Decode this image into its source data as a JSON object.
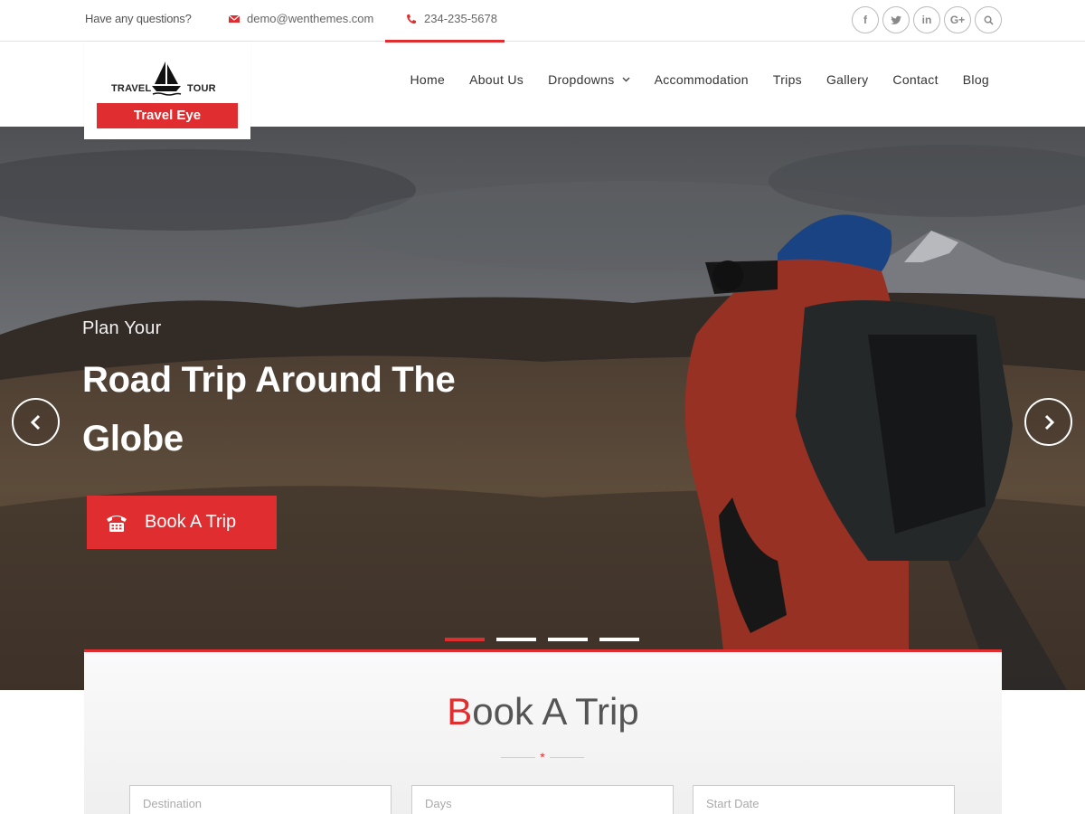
{
  "topbar": {
    "question": "Have any questions?",
    "email": "demo@wenthemes.com",
    "phone": "234-235-5678",
    "social": [
      {
        "icon": "facebook-icon",
        "glyph": "f"
      },
      {
        "icon": "twitter-icon",
        "glyph": "t"
      },
      {
        "icon": "linkedin-icon",
        "glyph": "in"
      },
      {
        "icon": "google-plus-icon",
        "glyph": "G+"
      },
      {
        "icon": "search-icon",
        "glyph": ""
      }
    ]
  },
  "logo": {
    "left_word": "TRAVEL",
    "right_word": "TOUR",
    "name": "Travel Eye"
  },
  "nav": {
    "items": [
      {
        "label": "Home"
      },
      {
        "label": "About Us"
      },
      {
        "label": "Dropdowns"
      },
      {
        "label": "Accommodation"
      },
      {
        "label": "Trips"
      },
      {
        "label": "Gallery"
      },
      {
        "label": "Contact"
      },
      {
        "label": "Blog"
      }
    ]
  },
  "hero": {
    "subtitle": "Plan Your",
    "title": "Road Trip Around The Globe",
    "button_label": "Book A Trip",
    "slides_total": 4,
    "active_slide": 1
  },
  "booking": {
    "title_first_letter": "B",
    "title_rest": "ook A Trip",
    "fields": [
      {
        "placeholder": "Destination"
      },
      {
        "placeholder": "Days"
      },
      {
        "placeholder": "Start Date"
      }
    ]
  },
  "colors": {
    "accent": "#e02d2f",
    "text": "#333333"
  }
}
